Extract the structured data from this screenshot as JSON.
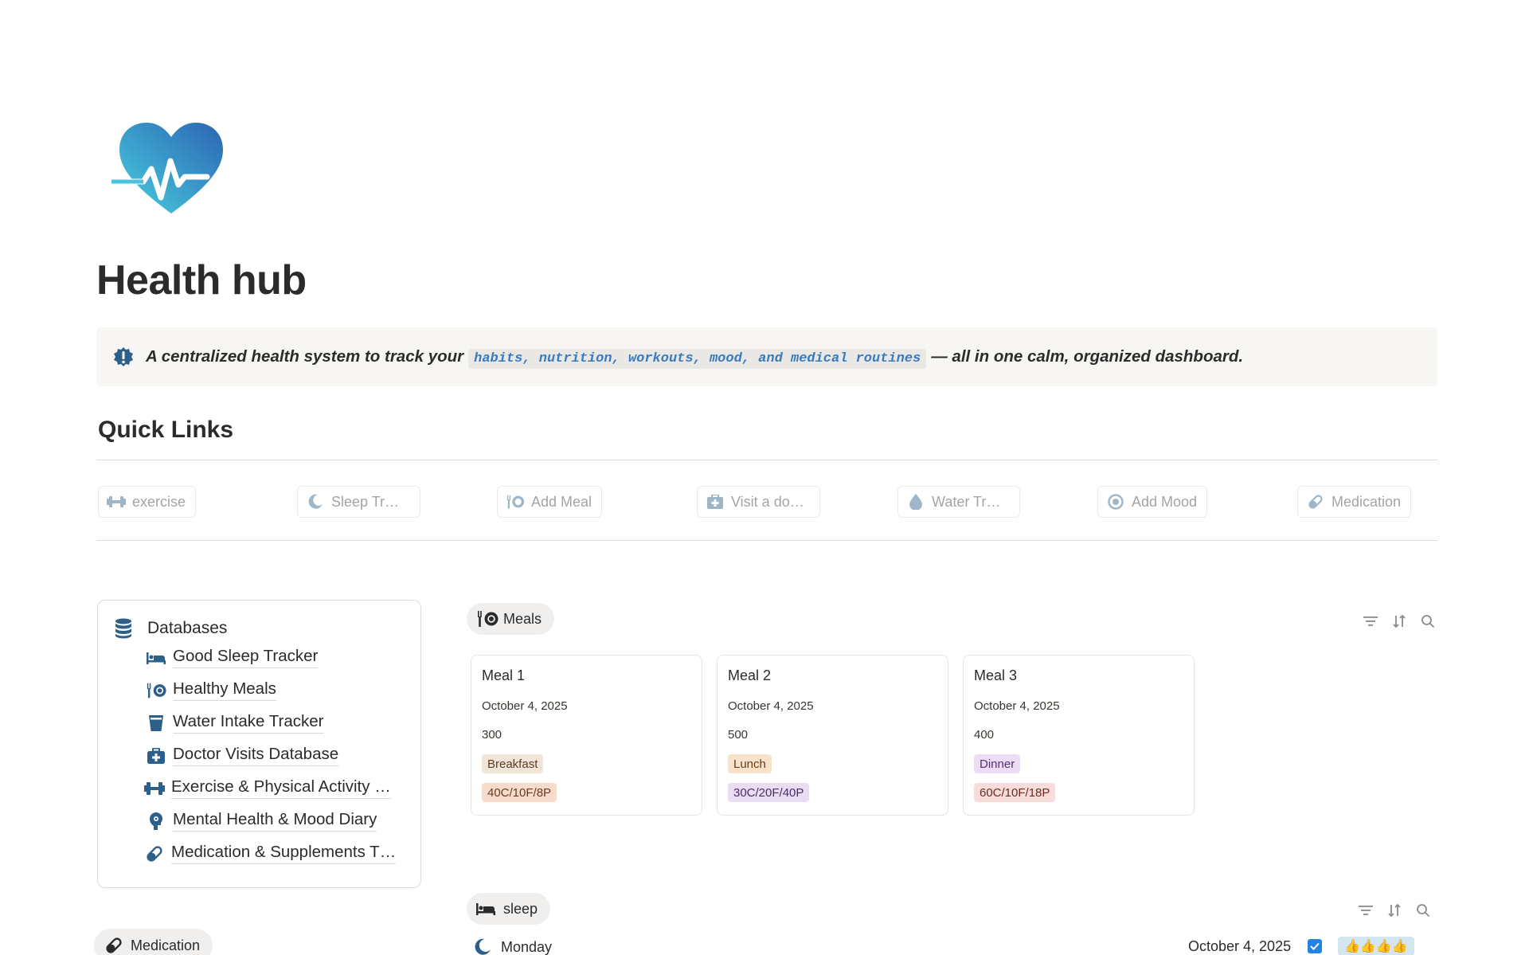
{
  "page": {
    "title": "Health hub",
    "icon": "heart-pulse-icon"
  },
  "callout": {
    "icon": "alert-badge-icon",
    "text_before": "A centralized health system to track your",
    "code": "habits, nutrition, workouts, mood, and medical routines",
    "text_after": "— all in one calm, organized dashboard."
  },
  "quick_links": {
    "heading": "Quick Links",
    "buttons": [
      {
        "label": "exercise",
        "icon": "dumbbell-icon"
      },
      {
        "label": "Sleep Tr…",
        "icon": "moon-icon"
      },
      {
        "label": "Add Meal",
        "icon": "fork-plate-icon"
      },
      {
        "label": "Visit a do…",
        "icon": "medical-kit-icon"
      },
      {
        "label": "Water Tr…",
        "icon": "water-drop-icon"
      },
      {
        "label": "Add Mood",
        "icon": "mood-target-icon"
      },
      {
        "label": "Medication",
        "icon": "pill-icon"
      }
    ]
  },
  "databases": {
    "heading": "Databases",
    "icon": "database-icon",
    "items": [
      {
        "label": "Good Sleep Tracker",
        "icon": "bed-icon"
      },
      {
        "label": "Healthy Meals",
        "icon": "fork-plate-icon"
      },
      {
        "label": "Water Intake Tracker",
        "icon": "cup-icon"
      },
      {
        "label": "Doctor Visits Database",
        "icon": "medical-kit-icon"
      },
      {
        "label": "Exercise & Physical Activity …",
        "icon": "dumbbell-icon"
      },
      {
        "label": "Mental Health & Mood Diary",
        "icon": "head-icon"
      },
      {
        "label": "Medication & Supplements T…",
        "icon": "pill-icon"
      }
    ]
  },
  "medication_view": {
    "label": "Medication",
    "icon": "pill-icon"
  },
  "meals_view": {
    "label": "Meals",
    "icon": "fork-plate-icon",
    "cards": [
      {
        "title": "Meal 1",
        "date": "October 4, 2025",
        "calories": "300",
        "meal_type": "Breakfast",
        "macros": "40C/10F/8P",
        "meal_type_bg": "#f1e4d8",
        "meal_type_fg": "#5c3b23",
        "macros_bg": "#f7dccb",
        "macros_fg": "#6b3a1f"
      },
      {
        "title": "Meal 2",
        "date": "October 4, 2025",
        "calories": "500",
        "meal_type": "Lunch",
        "macros": "30C/20F/40P",
        "meal_type_bg": "#f9e2cb",
        "meal_type_fg": "#6b3d16",
        "macros_bg": "#eadcf3",
        "macros_fg": "#4b2d63"
      },
      {
        "title": "Meal 3",
        "date": "October 4, 2025",
        "calories": "400",
        "meal_type": "Dinner",
        "macros": "60C/10F/18P",
        "meal_type_bg": "#ecdcf4",
        "meal_type_fg": "#5a2e74",
        "macros_bg": "#f8dcd9",
        "macros_fg": "#6e2b24"
      }
    ]
  },
  "sleep_view": {
    "label": "sleep",
    "icon": "bed-icon",
    "row": {
      "day": "Monday",
      "date": "October 4, 2025",
      "checked": true,
      "rating": "👍👍👍👍"
    }
  },
  "colors": {
    "accent_blue": "#2c5f8a",
    "checkbox_blue": "#2383e2",
    "heart_gradient_start": "#3ec4dc",
    "heart_gradient_end": "#2f6db8"
  }
}
